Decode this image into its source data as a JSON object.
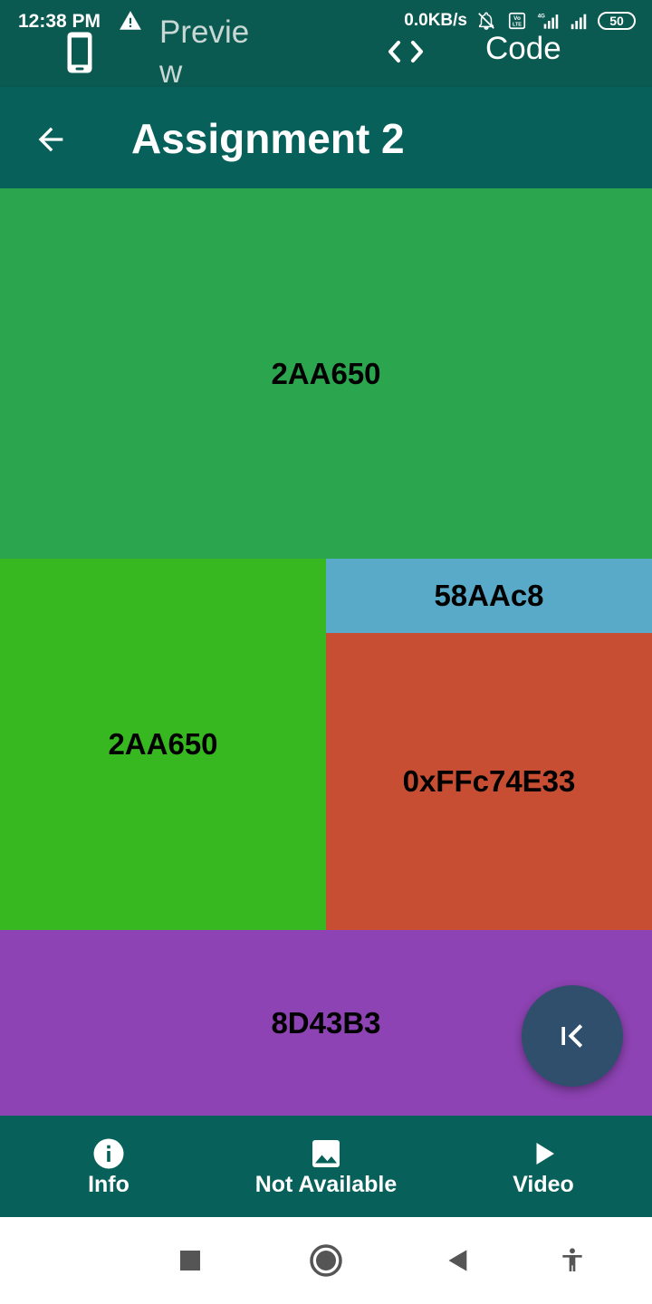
{
  "status_bar": {
    "time": "12:38 PM",
    "net_speed": "0.0KB/s",
    "network_label": "4G",
    "battery": "50"
  },
  "top_tabs": {
    "preview_label": "Preview",
    "code_label": "Code"
  },
  "app_bar": {
    "title": "Assignment 2"
  },
  "blocks": [
    {
      "label": "2AA650",
      "color": "#2ba64f"
    },
    {
      "label": "2AA650",
      "color": "#38b820"
    },
    {
      "label": "58AAc8",
      "color": "#58aac8"
    },
    {
      "label": "0xFFc74E33",
      "color": "#c74e33"
    },
    {
      "label": "8D43B3",
      "color": "#8d43b3"
    }
  ],
  "fab": {
    "icon": "first-page-icon"
  },
  "bottom_nav": [
    {
      "label": "Info",
      "icon": "info-icon"
    },
    {
      "label": "Not Available",
      "icon": "image-icon"
    },
    {
      "label": "Video",
      "icon": "play-icon"
    }
  ],
  "colors": {
    "primary": "#07605a",
    "top_bar": "#0b5a52",
    "fab": "#2f4f6d"
  }
}
